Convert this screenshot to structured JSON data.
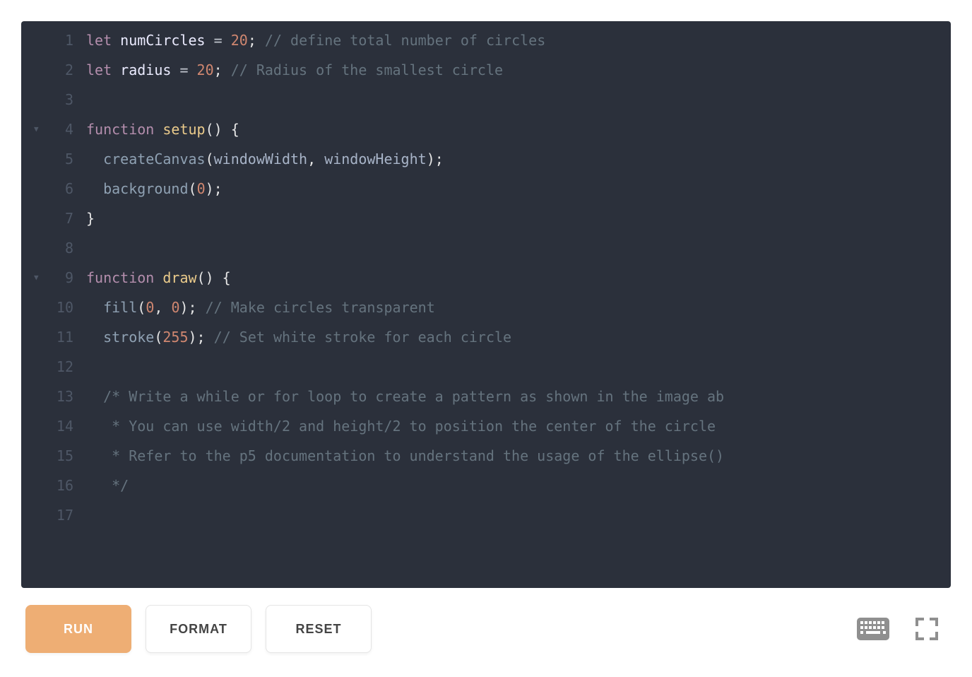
{
  "toolbar": {
    "run_label": "RUN",
    "format_label": "FORMAT",
    "reset_label": "RESET"
  },
  "icons": {
    "keyboard": "keyboard-icon",
    "fullscreen": "fullscreen-icon"
  },
  "code": {
    "folds": [
      4,
      9
    ],
    "lines": [
      {
        "n": 1,
        "tokens": [
          [
            "kw",
            "let "
          ],
          [
            "id",
            "numCircles"
          ],
          [
            "eq",
            " = "
          ],
          [
            "num",
            "20"
          ],
          [
            "pn",
            ";"
          ],
          [
            "cm",
            " // define total number of circles"
          ]
        ]
      },
      {
        "n": 2,
        "tokens": [
          [
            "kw",
            "let "
          ],
          [
            "id",
            "radius"
          ],
          [
            "eq",
            " = "
          ],
          [
            "num",
            "20"
          ],
          [
            "pn",
            ";"
          ],
          [
            "cm",
            " // Radius of the smallest circle"
          ]
        ]
      },
      {
        "n": 3,
        "tokens": []
      },
      {
        "n": 4,
        "tokens": [
          [
            "kw",
            "function "
          ],
          [
            "fn",
            "setup"
          ],
          [
            "pn",
            "() {"
          ]
        ]
      },
      {
        "n": 5,
        "tokens": [
          [
            "pn",
            "  "
          ],
          [
            "call",
            "createCanvas"
          ],
          [
            "pn",
            "("
          ],
          [
            "var",
            "windowWidth"
          ],
          [
            "pn",
            ", "
          ],
          [
            "var",
            "windowHeight"
          ],
          [
            "pn",
            ");"
          ]
        ]
      },
      {
        "n": 6,
        "tokens": [
          [
            "pn",
            "  "
          ],
          [
            "call",
            "background"
          ],
          [
            "pn",
            "("
          ],
          [
            "num",
            "0"
          ],
          [
            "pn",
            ");"
          ]
        ]
      },
      {
        "n": 7,
        "tokens": [
          [
            "pn",
            "}"
          ]
        ]
      },
      {
        "n": 8,
        "tokens": []
      },
      {
        "n": 9,
        "tokens": [
          [
            "kw",
            "function "
          ],
          [
            "fn",
            "draw"
          ],
          [
            "pn",
            "() {"
          ]
        ]
      },
      {
        "n": 10,
        "tokens": [
          [
            "pn",
            "  "
          ],
          [
            "call",
            "fill"
          ],
          [
            "pn",
            "("
          ],
          [
            "num",
            "0"
          ],
          [
            "pn",
            ", "
          ],
          [
            "num",
            "0"
          ],
          [
            "pn",
            ");"
          ],
          [
            "cm",
            " // Make circles transparent"
          ]
        ]
      },
      {
        "n": 11,
        "tokens": [
          [
            "pn",
            "  "
          ],
          [
            "call",
            "stroke"
          ],
          [
            "pn",
            "("
          ],
          [
            "num",
            "255"
          ],
          [
            "pn",
            ");"
          ],
          [
            "cm",
            " // Set white stroke for each circle"
          ]
        ]
      },
      {
        "n": 12,
        "tokens": []
      },
      {
        "n": 13,
        "tokens": [
          [
            "cm",
            "  /* Write a while or for loop to create a pattern as shown in the image ab"
          ]
        ]
      },
      {
        "n": 14,
        "tokens": [
          [
            "cm",
            "   * You can use width/2 and height/2 to position the center of the circle "
          ]
        ]
      },
      {
        "n": 15,
        "tokens": [
          [
            "cm",
            "   * Refer to the p5 documentation to understand the usage of the ellipse()"
          ]
        ]
      },
      {
        "n": 16,
        "tokens": [
          [
            "cm",
            "   */"
          ]
        ]
      },
      {
        "n": 17,
        "tokens": []
      }
    ]
  }
}
